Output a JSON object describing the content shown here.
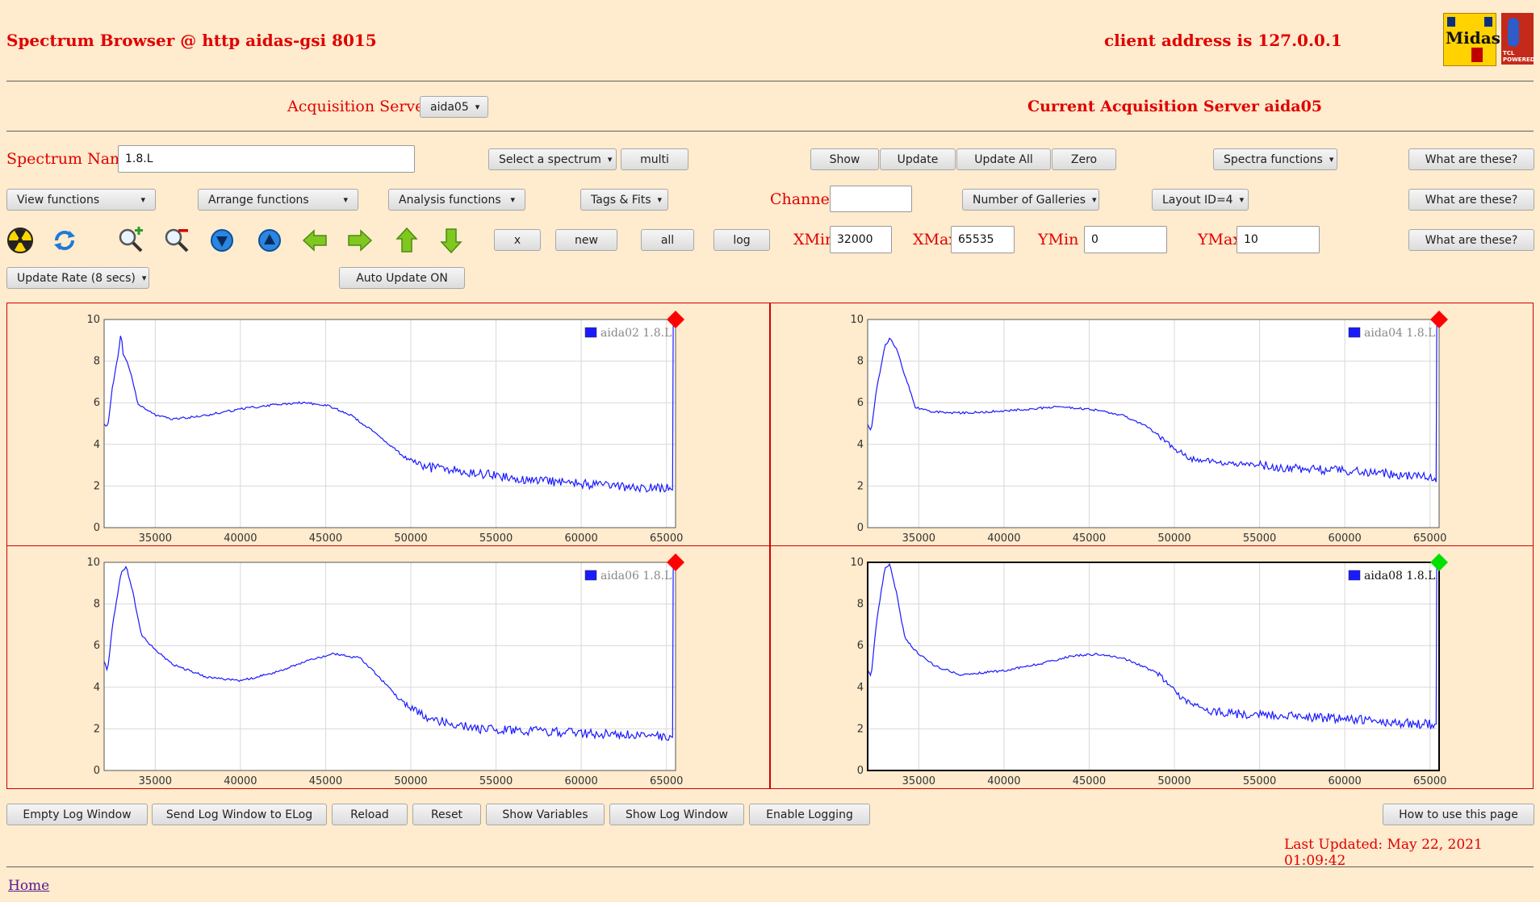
{
  "header": {
    "title": "Spectrum Browser @ http aidas-gsi 8015",
    "client_address": "client address is 127.0.0.1",
    "logo_midas": "Midas",
    "logo_tcl": "TCL POWERED"
  },
  "servers": {
    "label": "Acquisition Servers",
    "selected": "aida05",
    "current": "Current Acquisition Server aida05"
  },
  "spectrum": {
    "name_label": "Spectrum Name:",
    "name_value": "1.8.L",
    "select_label": "Select a spectrum",
    "multi_label": "multi",
    "show_label": "Show",
    "update_label": "Update",
    "update_all_label": "Update All",
    "zero_label": "Zero",
    "spectra_functions_label": "Spectra functions",
    "what_label": "What are these?"
  },
  "functions": {
    "view": "View functions",
    "arrange": "Arrange functions",
    "analysis": "Analysis functions",
    "tags": "Tags & Fits",
    "channel_label": "Channel:",
    "channel_value": "",
    "galleries": "Number of Galleries",
    "layout": "Layout ID=4"
  },
  "toolbar": {
    "icons": [
      "radiation-icon",
      "refresh-icon",
      "zoom-in-icon",
      "zoom-out-icon",
      "scroll-down-icon",
      "scroll-up-icon",
      "arrow-left-icon",
      "arrow-right-icon",
      "arrow-up-icon",
      "arrow-down-icon"
    ],
    "x_label": "x",
    "new_label": "new",
    "all_label": "all",
    "log_label": "log",
    "xmin_label": "XMin",
    "xmin_value": "32000",
    "xmax_label": "XMax",
    "xmax_value": "65535",
    "ymin_label": "YMin",
    "ymin_value": "0",
    "ymax_label": "YMax",
    "ymax_value": "10",
    "update_rate": "Update Rate (8 secs)",
    "auto_update": "Auto Update ON"
  },
  "bottom": {
    "empty_log": "Empty Log Window",
    "send_log": "Send Log Window to ELog",
    "reload": "Reload",
    "reset": "Reset",
    "show_variables": "Show Variables",
    "show_log": "Show Log Window",
    "enable_logging": "Enable Logging",
    "how_to": "How to use this page",
    "last_updated": "Last Updated: May 22, 2021 01:09:42",
    "home": "Home"
  },
  "colors": {
    "background": "#ffebcd",
    "accent_red": "#e00000",
    "series_blue": "#1a1aff",
    "marker_red": "#ff0000",
    "marker_green": "#00e000"
  },
  "chart_data": [
    {
      "type": "line",
      "legend": "aida02 1.8.L",
      "marker": "red",
      "xlim": [
        32000,
        65535
      ],
      "ylim": [
        0,
        10
      ],
      "xticks": [
        35000,
        40000,
        45000,
        50000,
        55000,
        60000,
        65000
      ],
      "yticks": [
        0,
        2,
        4,
        6,
        8,
        10
      ],
      "series": [
        {
          "x": [
            32000,
            32200,
            32500,
            32800,
            33000,
            33100,
            33300,
            33600,
            34000,
            35000,
            36000,
            38000,
            40000,
            42000,
            43500,
            45000,
            46500,
            48000,
            49000,
            50000,
            51000,
            53000,
            55000,
            57000,
            60000,
            62000,
            64000,
            65400
          ],
          "y": [
            5.0,
            4.8,
            6.8,
            8.2,
            9.4,
            8.3,
            8.1,
            7.3,
            5.9,
            5.4,
            5.2,
            5.4,
            5.7,
            5.9,
            6.0,
            5.9,
            5.4,
            4.5,
            3.8,
            3.2,
            2.9,
            2.7,
            2.5,
            2.3,
            2.1,
            2.0,
            1.9,
            1.9
          ]
        }
      ]
    },
    {
      "type": "line",
      "legend": "aida04 1.8.L",
      "marker": "red",
      "xlim": [
        32000,
        65535
      ],
      "ylim": [
        0,
        10
      ],
      "xticks": [
        35000,
        40000,
        45000,
        50000,
        55000,
        60000,
        65000
      ],
      "yticks": [
        0,
        2,
        4,
        6,
        8,
        10
      ],
      "series": [
        {
          "x": [
            32000,
            32200,
            32500,
            33000,
            33300,
            33700,
            34100,
            34400,
            34800,
            35500,
            37000,
            40000,
            43000,
            45000,
            47000,
            48500,
            50000,
            51000,
            53000,
            55000,
            58000,
            61000,
            64000,
            65400
          ],
          "y": [
            5.0,
            4.6,
            6.5,
            8.7,
            9.1,
            8.6,
            7.5,
            6.8,
            5.8,
            5.6,
            5.5,
            5.6,
            5.8,
            5.7,
            5.4,
            4.8,
            3.8,
            3.3,
            3.1,
            3.0,
            2.8,
            2.7,
            2.5,
            2.4
          ]
        }
      ]
    },
    {
      "type": "line",
      "legend": "aida06 1.8.L",
      "marker": "red",
      "xlim": [
        32000,
        65535
      ],
      "ylim": [
        0,
        10
      ],
      "xticks": [
        35000,
        40000,
        45000,
        50000,
        55000,
        60000,
        65000
      ],
      "yticks": [
        0,
        2,
        4,
        6,
        8,
        10
      ],
      "series": [
        {
          "x": [
            32000,
            32200,
            32500,
            33000,
            33300,
            33700,
            34200,
            35000,
            36000,
            38000,
            40000,
            42000,
            44000,
            45500,
            47000,
            48000,
            49500,
            50500,
            52000,
            54000,
            57000,
            60000,
            63000,
            65400
          ],
          "y": [
            5.2,
            4.8,
            7.0,
            9.5,
            9.8,
            8.5,
            6.5,
            5.8,
            5.1,
            4.5,
            4.3,
            4.7,
            5.3,
            5.6,
            5.4,
            4.6,
            3.3,
            2.7,
            2.3,
            2.0,
            1.9,
            1.8,
            1.7,
            1.6
          ]
        }
      ]
    },
    {
      "type": "line",
      "legend": "aida08 1.8.L",
      "marker": "green",
      "xlim": [
        32000,
        65535
      ],
      "ylim": [
        0,
        10
      ],
      "xticks": [
        35000,
        40000,
        45000,
        50000,
        55000,
        60000,
        65000
      ],
      "yticks": [
        0,
        2,
        4,
        6,
        8,
        10
      ],
      "series": [
        {
          "x": [
            32000,
            32200,
            32500,
            33000,
            33300,
            33700,
            34200,
            35000,
            36000,
            37500,
            40000,
            42000,
            44000,
            45500,
            47000,
            49000,
            50500,
            52000,
            54000,
            57000,
            60000,
            63000,
            65400
          ],
          "y": [
            4.8,
            4.5,
            7.0,
            9.7,
            9.9,
            8.5,
            6.3,
            5.6,
            5.0,
            4.6,
            4.8,
            5.1,
            5.5,
            5.6,
            5.4,
            4.7,
            3.4,
            2.9,
            2.7,
            2.6,
            2.5,
            2.3,
            2.2
          ]
        }
      ]
    }
  ]
}
